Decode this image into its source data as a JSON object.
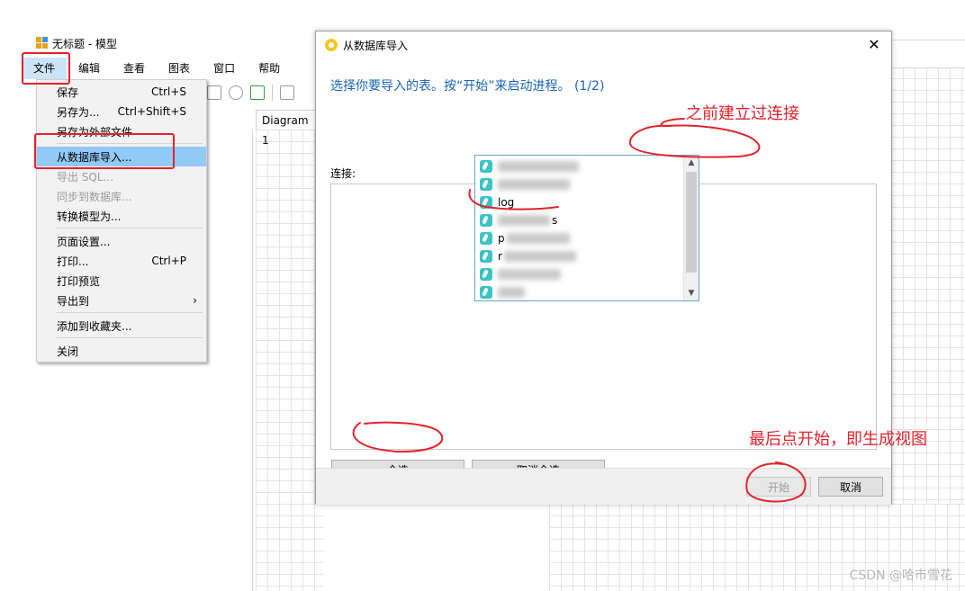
{
  "app": {
    "title": "无标题 - 模型",
    "menubar": [
      "文件",
      "编辑",
      "查看",
      "图表",
      "窗口",
      "帮助"
    ],
    "diagram_tab": "Diagram 1"
  },
  "file_menu": {
    "items": [
      {
        "label": "保存",
        "shortcut": "Ctrl+S"
      },
      {
        "label": "另存为...",
        "shortcut": "Ctrl+Shift+S"
      },
      {
        "label": "另存为外部文件",
        "shortcut": ""
      },
      {
        "label": "从数据库导入...",
        "shortcut": "",
        "highlighted": true
      },
      {
        "label": "导出 SQL...",
        "shortcut": "",
        "disabled": true
      },
      {
        "label": "同步到数据库...",
        "shortcut": "",
        "disabled": true
      },
      {
        "label": "转换模型为...",
        "shortcut": ""
      },
      {
        "label": "页面设置...",
        "shortcut": ""
      },
      {
        "label": "打印...",
        "shortcut": "Ctrl+P"
      },
      {
        "label": "打印预览",
        "shortcut": ""
      },
      {
        "label": "导出到",
        "shortcut": "",
        "submenu_arrow": "›"
      },
      {
        "label": "添加到收藏夹...",
        "shortcut": ""
      },
      {
        "label": "关闭",
        "shortcut": ""
      }
    ]
  },
  "dialog": {
    "title": "从数据库导入",
    "close_glyph": "✕",
    "instruction": "选择你要导入的表。按“开始”来启动进程。 (1/2)",
    "connection_label": "连接:",
    "combo_arrow": "⌄",
    "dropdown_items": [
      {
        "text": "",
        "blurred": true
      },
      {
        "text": "",
        "blurred": true
      },
      {
        "text": "log",
        "blurred": false
      },
      {
        "text": "s",
        "blurred": true
      },
      {
        "text": "p",
        "blurred": true
      },
      {
        "text": "r",
        "blurred": true
      },
      {
        "text": "",
        "blurred": true
      },
      {
        "text": "",
        "blurred": true
      }
    ],
    "buttons": {
      "select_all": "全选",
      "deselect_all": "取消全选",
      "start": "开始",
      "cancel": "取消"
    }
  },
  "annotations": {
    "connection_note": "之前建立过连接",
    "final_note": "最后点开始，即生成视图",
    "color": "#e4222c"
  },
  "watermark": "CSDN @哈市雪花"
}
